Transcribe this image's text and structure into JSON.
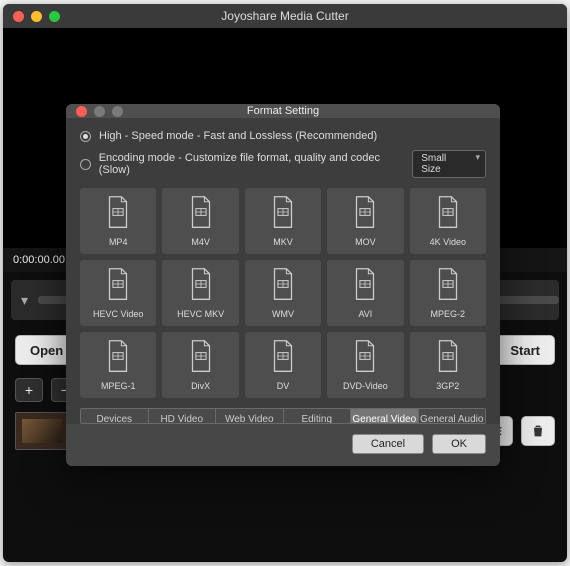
{
  "app": {
    "title": "Joyoshare Media Cutter"
  },
  "timeline": {
    "current": "0:00:00.00",
    "separator": "/"
  },
  "buttons": {
    "open": "Open",
    "start": "Start"
  },
  "segment": {
    "plus": "+",
    "minus": "−",
    "list": "≡"
  },
  "modal": {
    "title": "Format Setting",
    "mode_high": "High - Speed mode - Fast and Lossless (Recommended)",
    "mode_enc": "Encoding mode - Customize file format, quality and codec (Slow)",
    "size_dropdown": "Small Size",
    "formats": [
      "MP4",
      "M4V",
      "MKV",
      "MOV",
      "4K Video",
      "HEVC Video",
      "HEVC MKV",
      "WMV",
      "AVI",
      "MPEG-2",
      "MPEG-1",
      "DivX",
      "DV",
      "DVD-Video",
      "3GP2"
    ],
    "categories": [
      "Devices",
      "HD Video",
      "Web Video",
      "Editing",
      "General Video",
      "General Audio"
    ],
    "active_category": 4,
    "cancel": "Cancel",
    "ok": "OK"
  }
}
